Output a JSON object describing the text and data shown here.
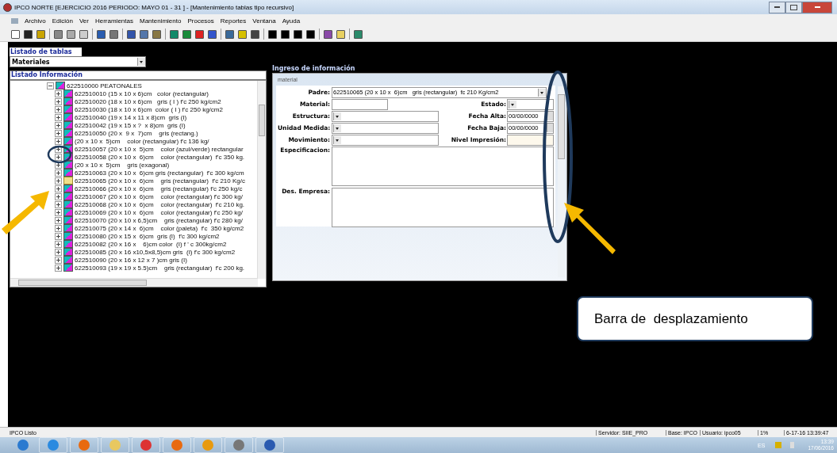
{
  "window": {
    "title": "IPCO NORTE [EJERCICIO 2016 PERIODO: MAYO 01 - 31 ] - [Mantenimiento tablas tipo recursivo]"
  },
  "menu": [
    "Archivo",
    "Edición",
    "Ver",
    "Herramientas",
    "Mantenimiento",
    "Procesos",
    "Reportes",
    "Ventana",
    "Ayuda"
  ],
  "tables_panel": {
    "label": "Listado de tablas",
    "value": "Materiales"
  },
  "tree_panel": {
    "label": "Listado Información",
    "tree": [
      {
        "code": "622510000",
        "text": "PEATONALES",
        "expanded": true,
        "selected": false,
        "children": [
          {
            "code": "622510010",
            "text": "(15 x 10 x 6)cm   color (rectangular)",
            "expanded": false,
            "selected": false
          },
          {
            "code": "622510020",
            "text": "(18 x 10 x 6)cm   gris ( I ) f'c 250 kg/cm2",
            "expanded": false,
            "selected": false
          },
          {
            "code": "622510030",
            "text": "(18 x 10 x 6)cm  color ( I ) f'c 250 kg/cm2",
            "expanded": false,
            "selected": false
          },
          {
            "code": "622510040",
            "text": "(19 x 14 x 11 x 8)cm  gris (I)",
            "expanded": false,
            "selected": false
          },
          {
            "code": "622510042",
            "text": "(19 x 15 x ?  x 8)cm  gris (I)",
            "expanded": false,
            "selected": false
          },
          {
            "code": "622510050",
            "text": "(20 x  9 x  7)cm    gris (rectang.)",
            "expanded": false,
            "selected": false
          },
          {
            "text": "(20 x 10 x  5)cm    color (rectangular) f'c 136 kg/",
            "expanded": false,
            "selected": false
          },
          {
            "code": "622510057",
            "text": "(20 x 10 x  5)cm    color (azul/verde) rectangular",
            "expanded": false,
            "selected": false
          },
          {
            "code": "622510058",
            "text": "(20 x 10 x  6)cm    color (rectangular)  f'c 350 kg.",
            "expanded": false,
            "selected": false
          },
          {
            "text": "(20 x 10 x  5)cm    gris (exagonal)",
            "expanded": false,
            "selected": false
          },
          {
            "code": "622510063",
            "text": "(20 x 10 x  6)cm gris (rectangular)  f'c 300 kg/cm",
            "expanded": false,
            "selected": false
          },
          {
            "code": "622510065",
            "text": "(20 x 10 x  6)cm    gris (rectangular)  f'c 210 Kg/c",
            "expanded": false,
            "selected": true
          },
          {
            "code": "622510066",
            "text": "(20 x 10 x  6)cm    gris (rectangular) f'c 250 kg/c",
            "expanded": false,
            "selected": false
          },
          {
            "code": "622510067",
            "text": "(20 x 10 x  6)cm    color (rectangular) f'c 300 kg/",
            "expanded": false,
            "selected": false
          },
          {
            "code": "622510068",
            "text": "(20 x 10 x  6)cm    color (rectangular)  f'c 210 kg.",
            "expanded": false,
            "selected": false
          },
          {
            "code": "622510069",
            "text": "(20 x 10 x  6)cm    color (rectangular) f'c 250 kg/",
            "expanded": false,
            "selected": false
          },
          {
            "code": "622510070",
            "text": "(20 x 10 x 6,5)cm    gris (rectangular) f'c 280 kg/",
            "expanded": false,
            "selected": false
          },
          {
            "code": "622510075",
            "text": "(20 x 14 x  6)cm    color (paleta)  f'c  350 kg/cm2",
            "expanded": false,
            "selected": false
          },
          {
            "code": "622510080",
            "text": "(20 x 15 x  6)cm  gris (I)  f'c 300 kg/cm2",
            "expanded": false,
            "selected": false
          },
          {
            "code": "622510082",
            "text": "(20 x 16 x    6)cm color  (I) f ' c 300kg/cm2",
            "expanded": false,
            "selected": false
          },
          {
            "code": "622510085",
            "text": "(20 x 16 x10,5x8,5)cm gris  (I) f'c 300 kg/cm2",
            "expanded": false,
            "selected": false
          },
          {
            "code": "622510090",
            "text": "(20 x 16 x 12 x 7 )cm gris (I)",
            "expanded": false,
            "selected": false
          },
          {
            "code": "622510093",
            "text": "(19 x 19 x 5.5)cm    gris (rectangular)  f'c 200 kg.",
            "expanded": false,
            "selected": false
          }
        ]
      }
    ]
  },
  "form_panel": {
    "label": "Ingreso de información",
    "group": "material",
    "padre": {
      "label": "Padre:",
      "value": "622510065 (20 x 10 x  6)cm   gris (rectangular)  fc 210 Kg/cm2"
    },
    "material": {
      "label": "Material:"
    },
    "estado": {
      "label": "Estado:"
    },
    "estructura": {
      "label": "Estructura:"
    },
    "fecha_alta": {
      "label": "Fecha Alta:",
      "value": "00/00/0000"
    },
    "unidad_medida": {
      "label": "Unidad Medida:"
    },
    "fecha_baja": {
      "label": "Fecha Baja:",
      "value": "00/00/0000"
    },
    "movimiento": {
      "label": "Movimiento:"
    },
    "nivel_impresion": {
      "label": "Nivel Impresión:"
    },
    "especificacion": {
      "label": "Especificacion:"
    },
    "des_empresa": {
      "label": "Des. Empresa:"
    }
  },
  "callout": {
    "text": "Barra de  desplazamiento"
  },
  "status_bar": {
    "message": "IPCO Listo",
    "server": "Servidor: SIIE_PRO",
    "base": "Base: IPCO",
    "user": "Usuario: ipco05",
    "percent": "1%",
    "timestamp": "6-17-16 13:39:47"
  },
  "taskbar": {
    "language": "ES",
    "time": "13:39",
    "date": "17/06/2016"
  }
}
